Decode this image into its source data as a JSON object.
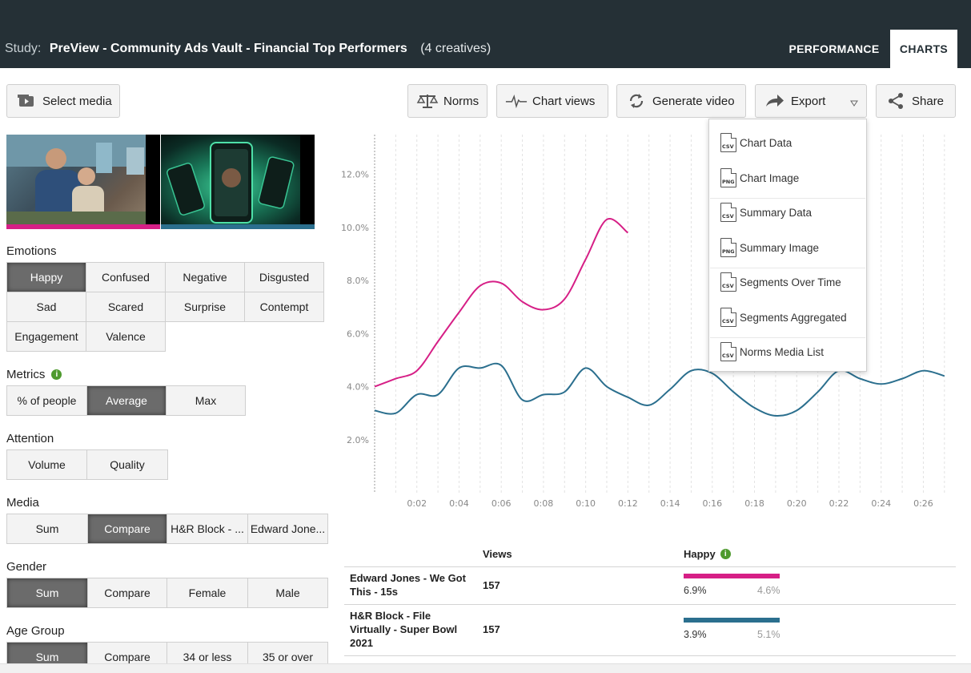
{
  "header": {
    "study_label": "Study:",
    "study_name": "PreView - Community Ads Vault - Financial Top Performers",
    "creatives_count": "(4 creatives)",
    "tabs": [
      "PERFORMANCE",
      "CHARTS"
    ],
    "active_tab": "CHARTS"
  },
  "toolbar": {
    "select_media": "Select media",
    "norms": "Norms",
    "chart_views": "Chart views",
    "generate_video": "Generate video",
    "export": "Export",
    "share": "Share"
  },
  "export_menu": [
    "Chart Data",
    "Chart Image",
    "Summary Data",
    "Summary Image",
    "Segments Over Time",
    "Segments Aggregated",
    "Norms Media List"
  ],
  "export_menu_badges": [
    "CSV",
    "PNG",
    "CSV",
    "PNG",
    "CSV",
    "CSV",
    "CSV"
  ],
  "filters": {
    "emotions": {
      "title": "Emotions",
      "options": [
        "Happy",
        "Confused",
        "Negative",
        "Disgusted",
        "Sad",
        "Scared",
        "Surprise",
        "Contempt",
        "Engagement",
        "Valence"
      ],
      "active": "Happy"
    },
    "metrics": {
      "title": "Metrics",
      "options": [
        "% of people",
        "Average",
        "Max"
      ],
      "active": "Average"
    },
    "attention": {
      "title": "Attention",
      "options": [
        "Volume",
        "Quality"
      ]
    },
    "media": {
      "title": "Media",
      "options": [
        "Sum",
        "Compare",
        "H&R Block - ...",
        "Edward Jone..."
      ],
      "active": "Compare"
    },
    "gender": {
      "title": "Gender",
      "options": [
        "Sum",
        "Compare",
        "Female",
        "Male"
      ],
      "active": "Sum"
    },
    "age_group": {
      "title": "Age Group",
      "options": [
        "Sum",
        "Compare",
        "34 or less",
        "35 or over"
      ],
      "active": "Sum"
    }
  },
  "colors": {
    "series_pink": "#d61f86",
    "series_teal": "#2b6f8e",
    "header_bg": "#253036"
  },
  "chart_data": {
    "type": "line",
    "ylim": [
      0,
      13.5
    ],
    "xlim": [
      0,
      27.5
    ],
    "y_ticks": [
      "2.0%",
      "4.0%",
      "6.0%",
      "8.0%",
      "10.0%",
      "12.0%"
    ],
    "x_ticks": [
      "0:02",
      "0:04",
      "0:06",
      "0:08",
      "0:10",
      "0:12",
      "0:14",
      "0:16",
      "0:18",
      "0:20",
      "0:22",
      "0:24",
      "0:26"
    ],
    "series": [
      {
        "color": "#d61f86",
        "x": [
          0,
          1,
          2,
          3,
          4,
          5,
          6,
          7,
          8,
          9,
          10,
          11,
          12
        ],
        "y": [
          4.0,
          4.3,
          4.6,
          5.7,
          6.8,
          7.8,
          7.9,
          7.2,
          6.9,
          7.3,
          8.8,
          10.3,
          9.8
        ]
      },
      {
        "color": "#2b6f8e",
        "x": [
          0,
          1,
          2,
          3,
          4,
          5,
          6,
          7,
          8,
          9,
          10,
          11,
          12,
          13,
          14,
          15,
          16,
          17,
          18,
          19,
          20,
          21,
          22,
          23,
          24,
          25,
          26,
          27
        ],
        "y": [
          3.1,
          3.0,
          3.7,
          3.7,
          4.7,
          4.7,
          4.8,
          3.5,
          3.7,
          3.8,
          4.7,
          4.0,
          3.6,
          3.3,
          3.9,
          4.6,
          4.5,
          3.8,
          3.2,
          2.9,
          3.1,
          3.8,
          4.6,
          4.3,
          4.1,
          4.3,
          4.6,
          4.4
        ]
      }
    ]
  },
  "table": {
    "headers": {
      "views": "Views",
      "metric": "Happy"
    },
    "rows": [
      {
        "name": "Edward Jones - We Got This - 15s",
        "views": "157",
        "value": "6.9%",
        "norm": "4.6%",
        "color": "#d61f86"
      },
      {
        "name": "H&R Block - File Virtually - Super Bowl 2021",
        "views": "157",
        "value": "3.9%",
        "norm": "5.1%",
        "color": "#2b6f8e"
      }
    ]
  }
}
